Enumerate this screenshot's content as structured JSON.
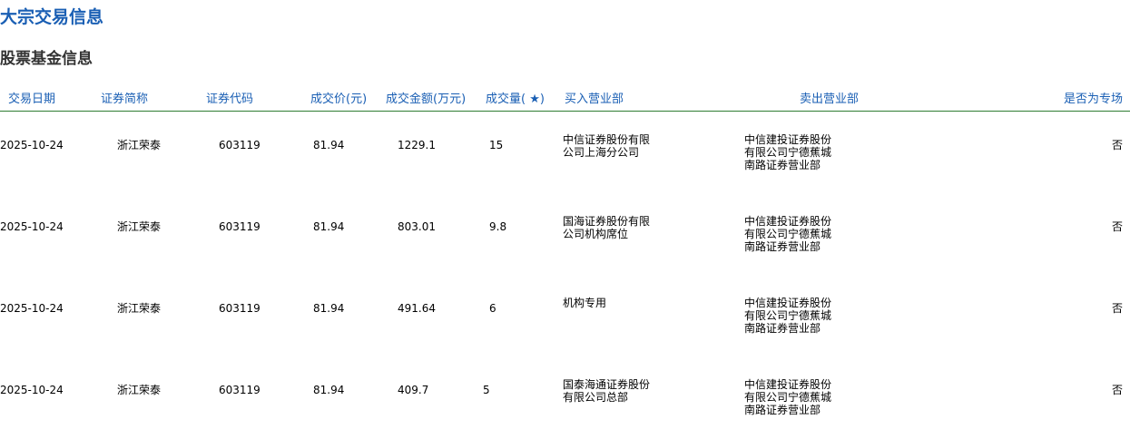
{
  "page": {
    "title": "大宗交易信息",
    "section_title": "股票基金信息"
  },
  "table": {
    "headers": {
      "date": "交易日期",
      "name": "证券简称",
      "code": "证券代码",
      "price": "成交价(元)",
      "amount": "成交金额(万元)",
      "volume": "成交量( ★)",
      "buyer": "买入营业部",
      "seller": "卖出营业部",
      "special": "是否为专场"
    },
    "rows": [
      {
        "date": "2025-10-24",
        "name": "浙江荣泰",
        "code": "603119",
        "price": "81.94",
        "amount": "1229.1",
        "volume": "15",
        "buyer": [
          "中信证券股份有限",
          "公司上海分公司"
        ],
        "seller": [
          "中信建投证券股份",
          "有限公司宁德蕉城",
          "南路证券营业部"
        ],
        "special": "否"
      },
      {
        "date": "2025-10-24",
        "name": "浙江荣泰",
        "code": "603119",
        "price": "81.94",
        "amount": "803.01",
        "volume": "9.8",
        "buyer": [
          "国海证券股份有限",
          "公司机构席位"
        ],
        "seller": [
          "中信建投证券股份",
          "有限公司宁德蕉城",
          "南路证券营业部"
        ],
        "special": "否"
      },
      {
        "date": "2025-10-24",
        "name": "浙江荣泰",
        "code": "603119",
        "price": "81.94",
        "amount": "491.64",
        "volume": "6",
        "buyer": [
          "机构专用"
        ],
        "seller": [
          "中信建投证券股份",
          "有限公司宁德蕉城",
          "南路证券营业部"
        ],
        "special": "否"
      },
      {
        "date": "2025-10-24",
        "name": "浙江荣泰",
        "code": "603119",
        "price": "81.94",
        "amount": "409.7",
        "volume": "5",
        "buyer": [
          "国泰海通证券股份",
          "有限公司总部"
        ],
        "seller": [
          "中信建投证券股份",
          "有限公司宁德蕉城",
          "南路证券营业部"
        ],
        "special": "否"
      }
    ]
  }
}
